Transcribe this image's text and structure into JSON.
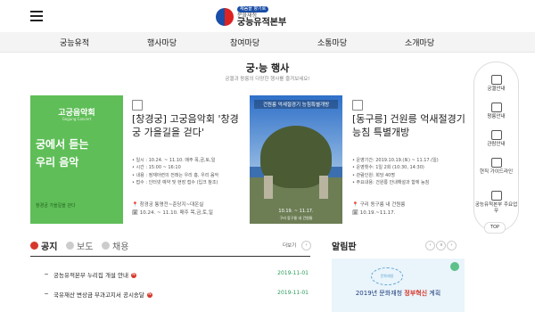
{
  "header": {
    "logo_badge": "채움을 향기로",
    "logo_sub": "문화재청",
    "logo_main": "궁능유적본부"
  },
  "nav": [
    "궁능유적",
    "행사마당",
    "참여마당",
    "소통마당",
    "소개마당"
  ],
  "section": {
    "title": "궁·능 행사",
    "subtitle": "궁궐과 왕릉의 다양한 행사를 즐겨보세요!"
  },
  "event1": {
    "poster_head": "고궁음악회",
    "poster_eng": "Gogung Concert",
    "poster_line1": "궁에서 듣는",
    "poster_line2": "우리 음악",
    "poster_bottom": "창경궁 가을길을 걷다",
    "title": "[창경궁] 고궁음악회 '창경궁 가을길을 걷다'",
    "details": [
      "• 일시 : 10.24. ~ 11.10. 매주 목,금,토,일",
      "• 시간 : 15:00 ~ 16:10",
      "• 내용 : 정재아련의 전래는 우리 흥, 우리 음악",
      "• 접수 : 인터넷 예약 및 현장 접수 (입크 참조)"
    ],
    "place": "창경궁 통명전~춘당지~대온실",
    "date": "10.24. ~ 11.10. 매주 목,금,토,일"
  },
  "event2": {
    "poster_title": "건원릉 억새절경기 능침특별개방",
    "poster_date": "10.19. ~ 11.17.",
    "poster_place": "구리 동구릉 내 건원릉",
    "title": "[동구릉] 건원릉 억새절경기 능침 특별개방",
    "details": [
      "• 운영기간: 2019.10.19.(토) ~ 11.17.(일)",
      "• 운영횟수: 1일 2회 (10:30, 14:30)",
      "• 관람인원: 회당 40명",
      "• 주요내용: 건원릉 안내해설과 함께 능침"
    ],
    "place": "구리 동구릉 내 건원릉",
    "date": "10.19.~11.17."
  },
  "tabs": [
    "공지",
    "보도",
    "채용"
  ],
  "more_label": "더보기",
  "notices": [
    {
      "title": "궁능유적본부 누리집 개설 안내",
      "date": "2019-11-01"
    },
    {
      "title": "국유재산 변상금 부과고지서 공시송달",
      "date": "2019-11-01"
    }
  ],
  "board": {
    "title": "알림판",
    "card_logo": "문화재청",
    "card_main_prefix": "2019년 문화재청 ",
    "card_main_red": "정부혁신",
    "card_main_suffix": " 계획"
  },
  "quick_links": [
    "궁궐안내",
    "왕릉안내",
    "관람안내",
    "현직 가이드라인",
    "궁능유적본부 주요업무"
  ],
  "top_label": "TOP",
  "colors": {
    "accent_green": "#5fbe58",
    "tab_red": "#d6372a",
    "date_green": "#2a9a5a"
  }
}
